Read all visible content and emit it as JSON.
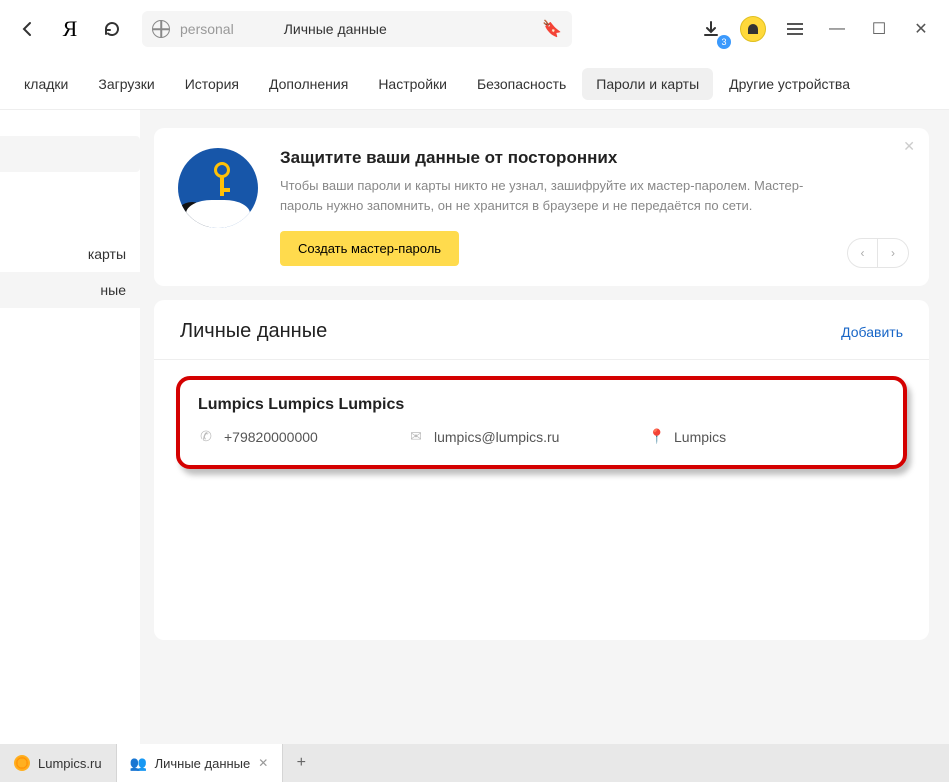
{
  "toolbar": {
    "omnibox_prefix": "personal",
    "omnibox_title": "Личные данные",
    "download_badge": "3"
  },
  "nav": {
    "items": [
      "кладки",
      "Загрузки",
      "История",
      "Дополнения",
      "Настройки",
      "Безопасность",
      "Пароли и карты",
      "Другие устройства"
    ],
    "active_index": 6
  },
  "sidebar": {
    "items": [
      "карты",
      "ные"
    ],
    "active_index": 1
  },
  "banner": {
    "title": "Защитите ваши данные от посторонних",
    "desc": "Чтобы ваши пароли и карты никто не узнал, зашифруйте их мастер-паролем. Мастер-пароль нужно запомнить, он не хранится в браузере и не передаётся по сети.",
    "button": "Создать мастер-пароль"
  },
  "card": {
    "title": "Личные данные",
    "add": "Добавить"
  },
  "entry": {
    "name": "Lumpics Lumpics Lumpics",
    "phone": "+79820000000",
    "email": "lumpics@lumpics.ru",
    "address": "Lumpics"
  },
  "tabs": {
    "t0": "Lumpics.ru",
    "t1": "Личные данные"
  }
}
